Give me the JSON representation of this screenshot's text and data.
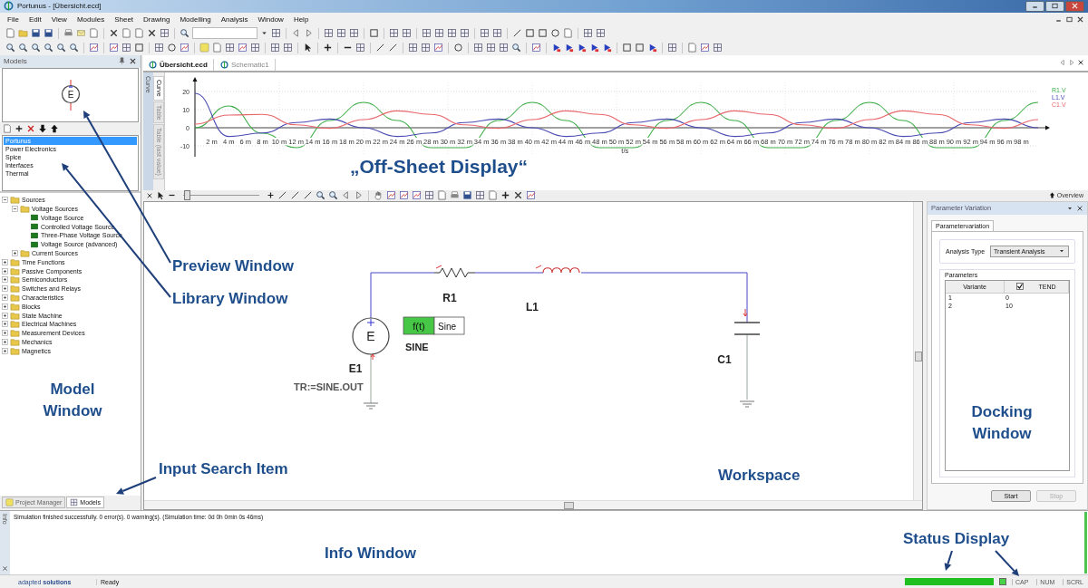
{
  "window": {
    "title": "Portunus - [Übersicht.ecd]"
  },
  "menu": [
    {
      "label": "File"
    },
    {
      "label": "Edit"
    },
    {
      "label": "View"
    },
    {
      "label": "Modules"
    },
    {
      "label": "Sheet"
    },
    {
      "label": "Drawing"
    },
    {
      "label": "Modelling"
    },
    {
      "label": "Analysis"
    },
    {
      "label": "Window"
    },
    {
      "label": "Help"
    }
  ],
  "models_panel": {
    "title": "Models",
    "preview": {
      "symbol": "E"
    },
    "libraries": [
      {
        "label": "Portunus",
        "selected": true
      },
      {
        "label": "Power Electronics",
        "selected": false
      },
      {
        "label": "Spice",
        "selected": false
      },
      {
        "label": "Interfaces",
        "selected": false
      },
      {
        "label": "Thermal",
        "selected": false
      }
    ],
    "tree": [
      {
        "label": "Sources",
        "kind": "folder",
        "expanded": true,
        "children": [
          {
            "label": "Voltage Sources",
            "kind": "folder",
            "expanded": true,
            "children": [
              {
                "label": "Voltage Source",
                "kind": "model"
              },
              {
                "label": "Controlled Voltage Source",
                "kind": "model"
              },
              {
                "label": "Three-Phase Voltage Source",
                "kind": "model"
              },
              {
                "label": "Voltage Source (advanced)",
                "kind": "model"
              }
            ]
          },
          {
            "label": "Current Sources",
            "kind": "folder",
            "expanded": false
          }
        ]
      },
      {
        "label": "Time Functions",
        "kind": "folder",
        "expanded": false
      },
      {
        "label": "Passive Components",
        "kind": "folder",
        "expanded": false
      },
      {
        "label": "Semiconductors",
        "kind": "folder",
        "expanded": false
      },
      {
        "label": "Switches and Relays",
        "kind": "folder",
        "expanded": false
      },
      {
        "label": "Characteristics",
        "kind": "folder",
        "expanded": false
      },
      {
        "label": "Blocks",
        "kind": "folder",
        "expanded": false
      },
      {
        "label": "State Machine",
        "kind": "folder",
        "expanded": false
      },
      {
        "label": "Electrical Machines",
        "kind": "folder",
        "expanded": false
      },
      {
        "label": "Measurement Devices",
        "kind": "folder",
        "expanded": false
      },
      {
        "label": "Mechanics",
        "kind": "folder",
        "expanded": false
      },
      {
        "label": "Magnetics",
        "kind": "folder",
        "expanded": false
      }
    ],
    "tabs": [
      {
        "label": "Project Manager",
        "selected": false
      },
      {
        "label": "Models",
        "selected": true
      }
    ]
  },
  "documents": [
    {
      "label": "Übersicht.ecd",
      "selected": true
    },
    {
      "label": "Schematic1",
      "selected": false
    }
  ],
  "display": {
    "outer_tab": "Curve",
    "side_tabs": [
      {
        "label": "Curve",
        "selected": true
      },
      {
        "label": "Table",
        "selected": false
      },
      {
        "label": "Table (last value)",
        "selected": false
      }
    ],
    "chart_data": {
      "type": "line",
      "grid": true,
      "xlabel": "t/s",
      "x": [
        0,
        4,
        8,
        12,
        16,
        20,
        24,
        28,
        32,
        36,
        40,
        44,
        48,
        52,
        56,
        60,
        64,
        68,
        72,
        76,
        80,
        84,
        88,
        92,
        96,
        100
      ],
      "series": [
        {
          "name": "R1.V",
          "color": "#3fae49",
          "values": [
            0,
            12,
            -3,
            -11,
            4,
            14,
            4,
            -11,
            -11,
            4,
            14,
            4,
            -11,
            -11,
            4,
            14,
            4,
            -11,
            -11,
            4,
            14,
            4,
            -11,
            -11,
            4,
            14
          ]
        },
        {
          "name": "L1.V",
          "color": "#4b4bb4",
          "values": [
            19,
            -4.8,
            -2.9,
            2.9,
            4.8,
            0,
            -4.8,
            -2.9,
            2.9,
            4.8,
            0,
            -4.8,
            -2.9,
            2.9,
            4.8,
            0,
            -4.8,
            -2.9,
            2.9,
            4.8,
            0,
            -4.8,
            -2.9,
            2.9,
            4.8,
            0
          ]
        },
        {
          "name": "C1.V",
          "color": "#e8666a",
          "values": [
            2,
            7,
            7.4,
            1.6,
            -0.3,
            4.5,
            9.3,
            7.4,
            1.6,
            -0.3,
            4.5,
            9.3,
            7.4,
            1.6,
            -0.3,
            4.5,
            9.3,
            7.4,
            1.6,
            -0.3,
            4.5,
            9.3,
            7.4,
            1.6,
            -0.3,
            4.5
          ]
        }
      ],
      "xlim": [
        0,
        100
      ],
      "ylim": [
        -15,
        25
      ],
      "yticks": [
        -10,
        0,
        10,
        20
      ],
      "xticks": [
        {
          "value": 2,
          "label": "2 m"
        },
        {
          "value": 4,
          "label": "4 m"
        },
        {
          "value": 6,
          "label": "6 m"
        },
        {
          "value": 8,
          "label": "8 m"
        },
        {
          "value": 10,
          "label": "10 m"
        },
        {
          "value": 12,
          "label": "12 m"
        },
        {
          "value": 14,
          "label": "14 m"
        },
        {
          "value": 16,
          "label": "16 m"
        },
        {
          "value": 18,
          "label": "18 m"
        },
        {
          "value": 20,
          "label": "20 m"
        },
        {
          "value": 22,
          "label": "22 m"
        },
        {
          "value": 24,
          "label": "24 m"
        },
        {
          "value": 26,
          "label": "26 m"
        },
        {
          "value": 28,
          "label": "28 m"
        },
        {
          "value": 30,
          "label": "30 m"
        },
        {
          "value": 32,
          "label": "32 m"
        },
        {
          "value": 34,
          "label": "34 m"
        },
        {
          "value": 36,
          "label": "36 m"
        },
        {
          "value": 38,
          "label": "38 m"
        },
        {
          "value": 40,
          "label": "40 m"
        },
        {
          "value": 42,
          "label": "42 m"
        },
        {
          "value": 44,
          "label": "44 m"
        },
        {
          "value": 46,
          "label": "46 m"
        },
        {
          "value": 48,
          "label": "48 m"
        },
        {
          "value": 50,
          "label": "50 m"
        },
        {
          "value": 52,
          "label": "52 m"
        },
        {
          "value": 54,
          "label": "54 m"
        },
        {
          "value": 56,
          "label": "56 m"
        },
        {
          "value": 58,
          "label": "58 m"
        },
        {
          "value": 60,
          "label": "60 m"
        },
        {
          "value": 62,
          "label": "62 m"
        },
        {
          "value": 64,
          "label": "64 m"
        },
        {
          "value": 66,
          "label": "66 m"
        },
        {
          "value": 68,
          "label": "68 m"
        },
        {
          "value": 70,
          "label": "70 m"
        },
        {
          "value": 72,
          "label": "72 m"
        },
        {
          "value": 74,
          "label": "74 m"
        },
        {
          "value": 76,
          "label": "76 m"
        },
        {
          "value": 78,
          "label": "78 m"
        },
        {
          "value": 80,
          "label": "80 m"
        },
        {
          "value": 82,
          "label": "82 m"
        },
        {
          "value": 84,
          "label": "84 m"
        },
        {
          "value": 86,
          "label": "86 m"
        },
        {
          "value": 88,
          "label": "88 m"
        },
        {
          "value": 90,
          "label": "90 m"
        },
        {
          "value": 92,
          "label": "92 m"
        },
        {
          "value": 94,
          "label": "94 m"
        },
        {
          "value": 96,
          "label": "96 m"
        },
        {
          "value": 98,
          "label": "98 m"
        }
      ]
    },
    "zoom_slider": {
      "level": 0.05
    },
    "overview": "Overview"
  },
  "schematic": {
    "source": {
      "symbol": "E",
      "name": "E1",
      "assignment": "TR:=SINE.OUT"
    },
    "function_block": {
      "symbol": "f(t)",
      "value": "Sine",
      "name": "SINE"
    },
    "resistor": "R1",
    "inductor": "L1",
    "capacitor": "C1"
  },
  "docking": {
    "title": "Parameter Variation",
    "tab": "Parametervariation",
    "analysis_label": "Analysis Type",
    "analysis_value": "Transient Analysis",
    "group": "Parameters",
    "columns": [
      {
        "label": "Variante"
      },
      {
        "label": "TEND",
        "checked": true
      }
    ],
    "rows": [
      [
        "1",
        "0"
      ],
      [
        "2",
        "10"
      ]
    ],
    "buttons": [
      {
        "label": "Start",
        "disabled": false
      },
      {
        "label": "Stop",
        "disabled": true
      }
    ]
  },
  "info": {
    "tab": "Info",
    "message": "Simulation finished successfully. 0 error(s). 0 warning(s). (Simulation time: 0d 0h 0min 0s 46ms)"
  },
  "status_bar": {
    "brand": "adapted **solutions**",
    "text": "Ready",
    "progress": {
      "level": 1
    },
    "indicator": {
      "on": true
    },
    "keys": [
      "CAP",
      "NUM",
      "SCRL"
    ]
  },
  "annotations": [
    {
      "text": "„Off-Sheet Display“"
    },
    {
      "text": "Preview Window"
    },
    {
      "text": "Library Window"
    },
    {
      "text": "Model Window"
    },
    {
      "text": "Input Search Item"
    },
    {
      "text": "Workspace"
    },
    {
      "text": "Docking Window"
    },
    {
      "text": "Info Window"
    },
    {
      "text": "Status Display"
    }
  ]
}
